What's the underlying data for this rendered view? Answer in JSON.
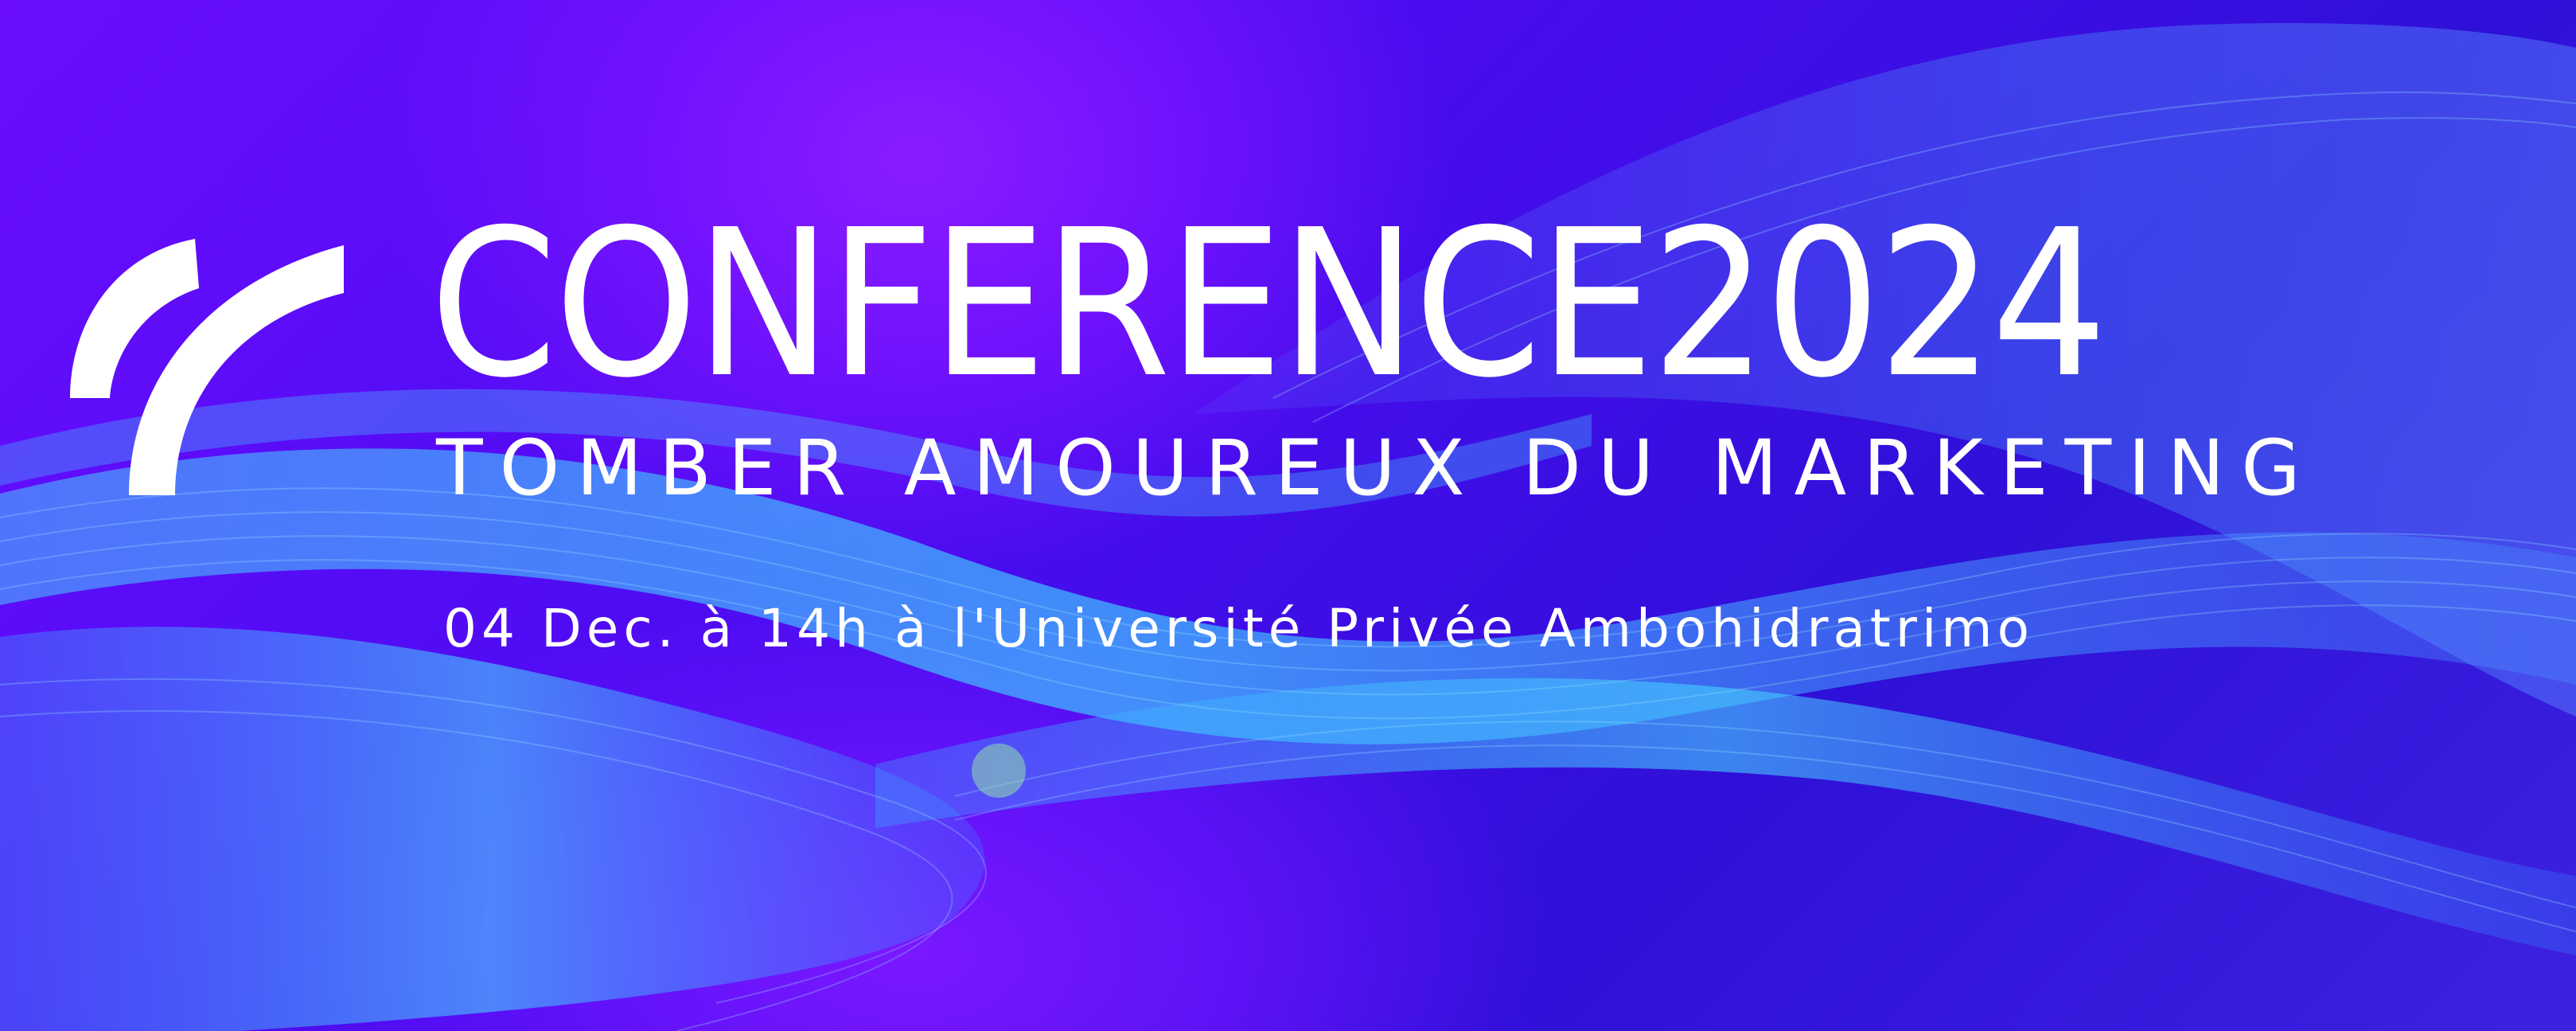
{
  "banner": {
    "title": "CONFERENCE2024",
    "subtitle": "TOMBER AMOUREUX DU MARKETING",
    "details": "04 Dec. à 14h à l'Université Privée Ambohidratrimo"
  },
  "logo": {
    "icon": "signal-arcs-icon"
  },
  "colors": {
    "background_primary": "#5a0df8",
    "background_deep": "#2f10d8",
    "wave_cyan": "#3fd0ff",
    "text": "#ffffff"
  }
}
